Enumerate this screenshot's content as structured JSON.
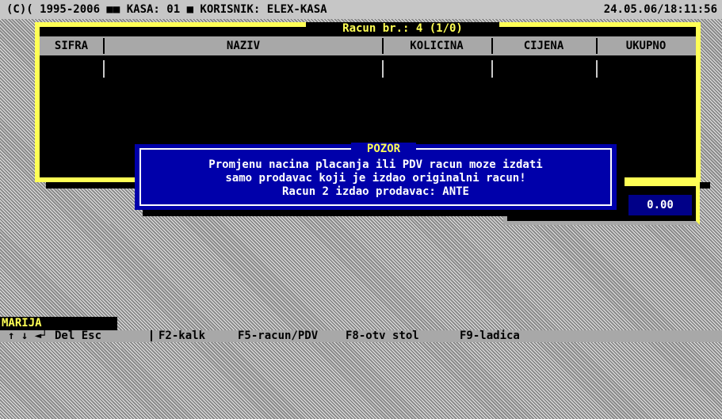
{
  "topbar": {
    "left_text": "(C)( 1995-2006 ■■ KASA: 01 ■ KORISNIK: ELEX-KASA",
    "datetime": "24.05.06/18:11:56"
  },
  "receipt": {
    "title": "Racun br.: 4 (1/0)",
    "columns": [
      "SIFRA",
      "NAZIV",
      "KOLICINA",
      "CIJENA",
      "UKUPNO"
    ],
    "total": "0.00"
  },
  "dialog": {
    "title": "POZOR",
    "lines": [
      "Promjenu nacina placanja ili PDV racun moze izdati",
      "samo prodavac koji je izdao originalni racun!",
      "Racun 2 izdao prodavac: ANTE"
    ]
  },
  "footer": {
    "user": "MARIJA",
    "keys": [
      "↑ ↓ ◄┘ Del Esc",
      "F2-kalk",
      "F5-racun/PDV",
      "F8-otv stol",
      "F9-ladica"
    ]
  },
  "colors": {
    "frame": "#ffff55",
    "dialog_bg": "#0000aa",
    "desktop": "#bcbcbc"
  }
}
